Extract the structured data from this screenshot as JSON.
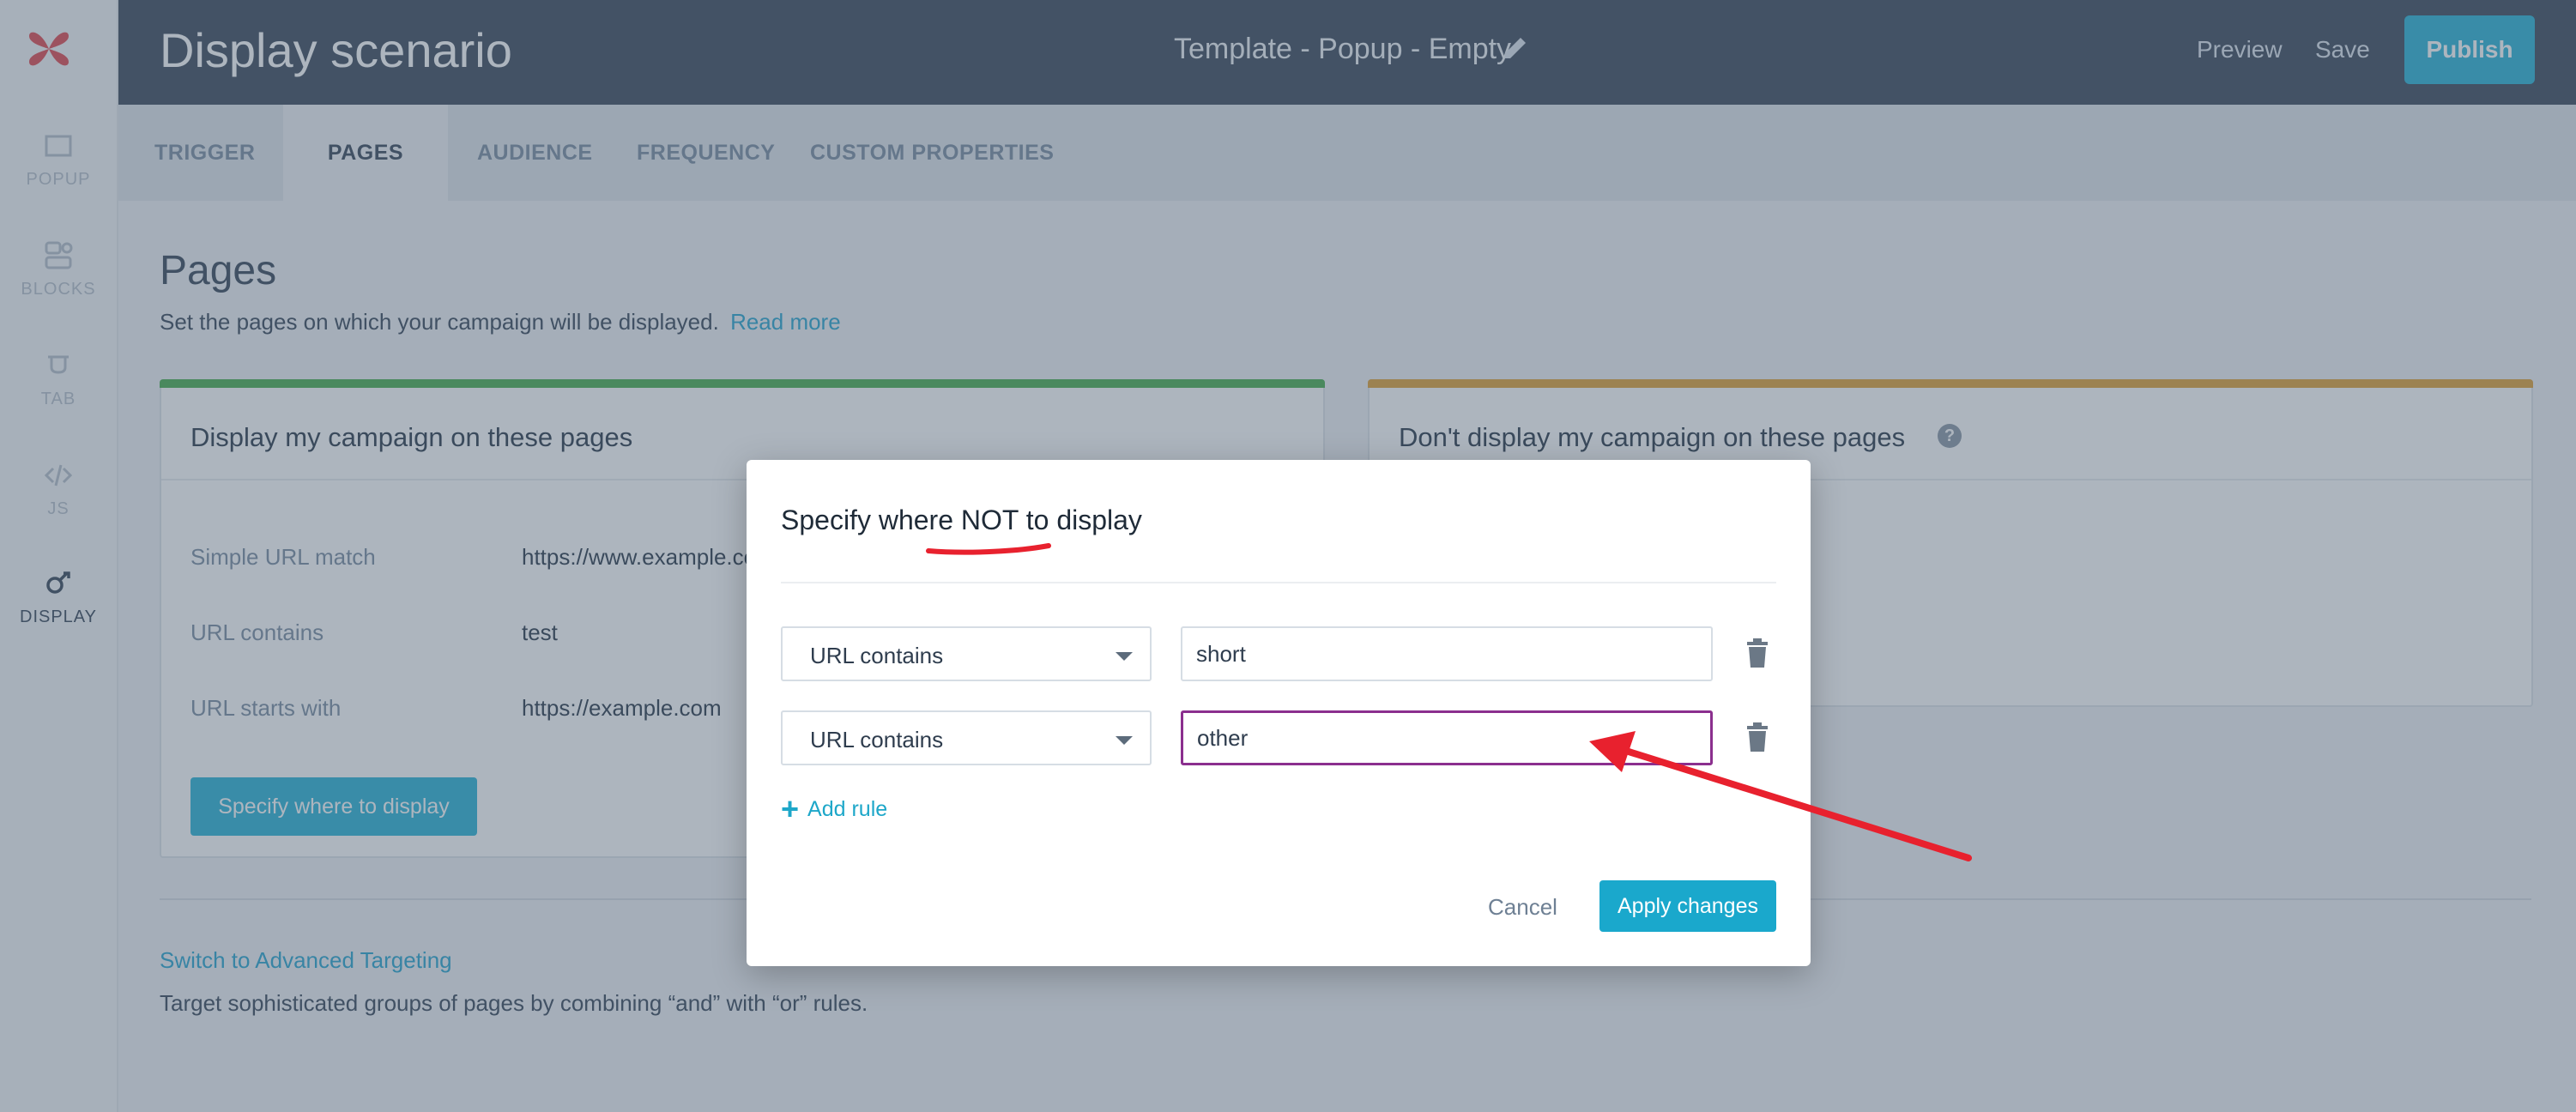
{
  "app": {
    "title": "Display scenario",
    "template_name": "Template - Popup - Empty",
    "preview_label": "Preview",
    "save_label": "Save",
    "publish_label": "Publish"
  },
  "sidebar": {
    "items": [
      {
        "label": "POPUP",
        "icon": "popup-icon"
      },
      {
        "label": "BLOCKS",
        "icon": "blocks-icon"
      },
      {
        "label": "TAB",
        "icon": "tab-icon"
      },
      {
        "label": "JS",
        "icon": "code-icon"
      },
      {
        "label": "DISPLAY",
        "icon": "display-icon",
        "active": true
      }
    ]
  },
  "tabs": [
    {
      "label": "TRIGGER"
    },
    {
      "label": "PAGES",
      "active": true
    },
    {
      "label": "AUDIENCE"
    },
    {
      "label": "FREQUENCY"
    },
    {
      "label": "CUSTOM PROPERTIES"
    }
  ],
  "page": {
    "title": "Pages",
    "description": "Set the pages on which your campaign will be displayed.",
    "read_more": "Read more"
  },
  "display_card": {
    "title": "Display my campaign on these pages",
    "rules": [
      {
        "type": "Simple URL match",
        "value": "https://www.example.com"
      },
      {
        "type": "URL contains",
        "value": "test"
      },
      {
        "type": "URL starts with",
        "value": "https://example.com"
      }
    ],
    "button_label": "Specify where to display"
  },
  "exclude_card": {
    "title": "Don't display my campaign on these pages",
    "help": "?"
  },
  "advanced": {
    "link": "Switch to Advanced Targeting",
    "description": "Target sophisticated groups of pages by combining “and” with “or” rules."
  },
  "modal": {
    "title": "Specify where NOT to display",
    "rules": [
      {
        "type": "URL contains",
        "value": "short"
      },
      {
        "type": "URL contains",
        "value": "other"
      }
    ],
    "add_rule": "Add rule",
    "cancel": "Cancel",
    "apply": "Apply changes"
  },
  "colors": {
    "header": "#3e4c5e",
    "accent": "#2cb5d8",
    "display_bar": "#4caf50",
    "exclude_bar": "#e0a23a",
    "focus_border": "#8b2f8e",
    "annotation": "#e8212e"
  }
}
